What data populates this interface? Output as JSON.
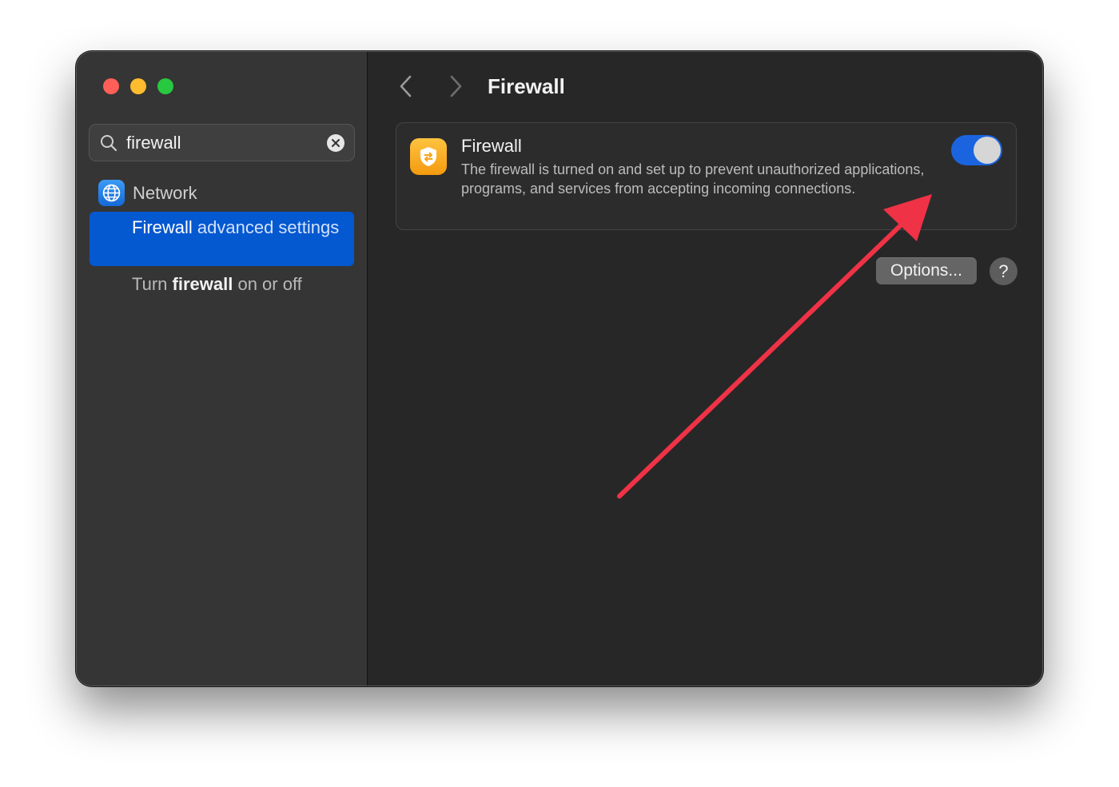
{
  "window": {
    "traffic_lights": [
      "close",
      "minimize",
      "zoom"
    ]
  },
  "sidebar": {
    "search": {
      "value": "firewall"
    },
    "section": {
      "label": "Network",
      "icon": "globe-icon"
    },
    "selected_item": {
      "highlight": "Firewall",
      "rest": " advanced settings"
    },
    "item": {
      "prefix": "Turn ",
      "highlight": "firewall",
      "suffix": " on or off"
    }
  },
  "header": {
    "title": "Firewall"
  },
  "firewall_card": {
    "icon": "firewall-shield-icon",
    "title": "Firewall",
    "description": "The firewall is turned on and set up to prevent unauthorized applications, programs, and services from accepting incoming connections.",
    "toggle_on": true
  },
  "buttons": {
    "options": "Options...",
    "help": "?"
  },
  "colors": {
    "accent": "#0458d0",
    "toggle": "#1a64e0",
    "annotation_arrow": "#f03246"
  }
}
